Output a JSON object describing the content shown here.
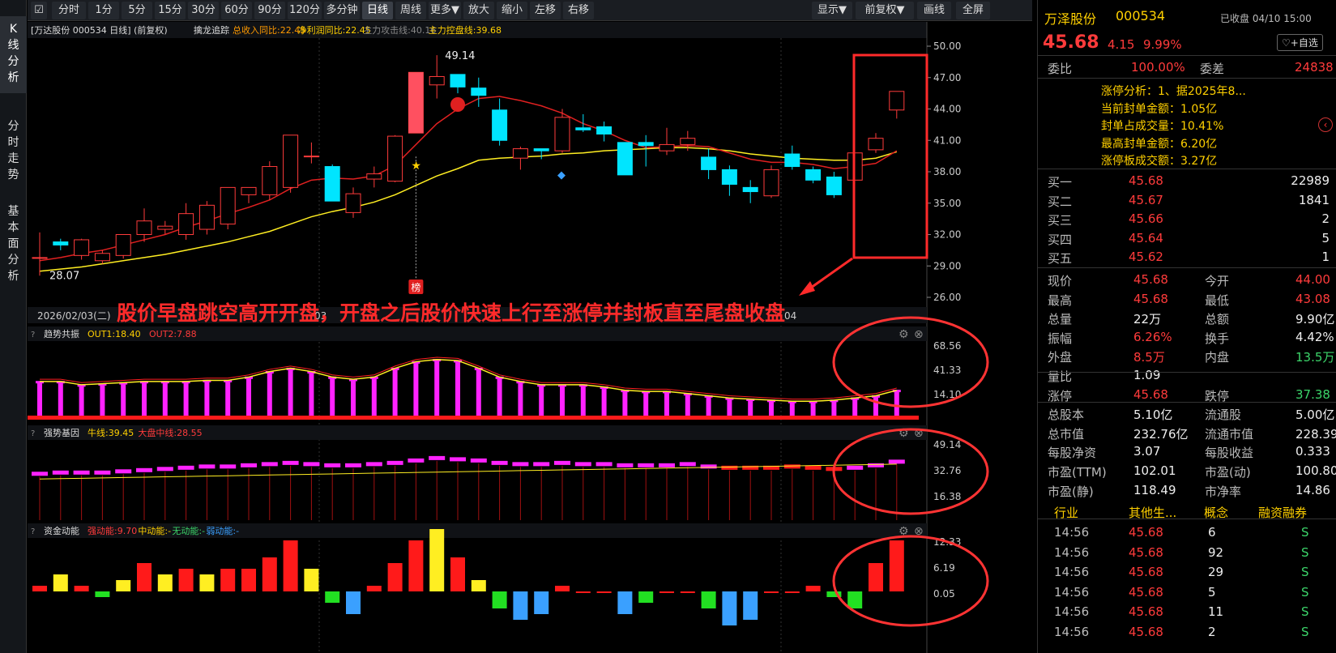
{
  "sidebar": {
    "tabs": [
      "K\n线\n分\n析",
      "分\n时\n走\n势",
      "基\n本\n面\n分\n析"
    ]
  },
  "toolbar": {
    "buttons": [
      "分时",
      "1分",
      "5分",
      "15分",
      "30分",
      "60分",
      "90分",
      "120分",
      "多分钟",
      "日线",
      "周线",
      "更多▼",
      "放大",
      "缩小",
      "左移",
      "右移"
    ],
    "active": "日线",
    "right_buttons": [
      "显示▼",
      "前复权▼",
      "画线",
      "全屏"
    ]
  },
  "main_header": {
    "title": "[万达股份 000534 日线]  (前复权)",
    "indicator": "擒龙追踪",
    "items": [
      "总收入同比:22.45",
      "净利润同比:22.45",
      "主力攻击线:40.16",
      "主力控盘线:39.68"
    ]
  },
  "price_axis": [
    "50.00",
    "47.00",
    "44.00",
    "41.00",
    "38.00",
    "35.00",
    "32.00",
    "29.00",
    "26.00"
  ],
  "annotations": {
    "high": "49.14",
    "low": "28.07",
    "date": "2026/02/03(二)",
    "month_mid": "03",
    "month_right": "04",
    "bang": "榜",
    "caption": "股价早盘跳空高开开盘，开盘之后股价快速上行至涨停并封板直至尾盘收盘"
  },
  "panel1": {
    "name": "趋势共振",
    "out1": "OUT1:18.40",
    "out2": "OUT2:7.88",
    "axis": [
      "68.56",
      "41.33",
      "14.10"
    ]
  },
  "panel2": {
    "name": "强势基因",
    "l1": "牛线:39.45",
    "l2": "大盘中线:28.55",
    "axis": [
      "49.14",
      "32.76",
      "16.38"
    ]
  },
  "panel3": {
    "name": "资金动能",
    "l1": "强动能:9.70",
    "l2": "中动能:-",
    "l3": "无动能:-",
    "l4": "弱动能:-",
    "axis": [
      "12.33",
      "6.19",
      "0.05"
    ]
  },
  "stock": {
    "name": "万泽股份",
    "code": "000534",
    "status": "已收盘 04/10 15:00",
    "price": "45.68",
    "change": "4.15",
    "pct": "9.99%",
    "fav": "+自选"
  },
  "weibi": {
    "label1": "委比",
    "val1": "100.00%",
    "label2": "委差",
    "val2": "24838"
  },
  "limit": {
    "lines": [
      "涨停分析：1、据2025年8...",
      "当前封单金额：1.05亿",
      "封单占成交量：10.41%",
      "最高封单金额：6.20亿",
      "涨停板成交额：3.27亿"
    ]
  },
  "bids": [
    [
      "买一",
      "45.68",
      "22989"
    ],
    [
      "买二",
      "45.67",
      "1841"
    ],
    [
      "买三",
      "45.66",
      "2"
    ],
    [
      "买四",
      "45.64",
      "5"
    ],
    [
      "买五",
      "45.62",
      "1"
    ]
  ],
  "quote": [
    [
      "现价",
      "45.68",
      "今开",
      "44.00"
    ],
    [
      "最高",
      "45.68",
      "最低",
      "43.08"
    ],
    [
      "总量",
      "22万",
      "总额",
      "9.90亿"
    ],
    [
      "振幅",
      "6.26%",
      "换手",
      "4.42%"
    ],
    [
      "外盘",
      "8.5万",
      "内盘",
      "13.5万"
    ],
    [
      "量比",
      "1.09",
      "",
      ""
    ],
    [
      "涨停",
      "45.68",
      "跌停",
      "37.38"
    ],
    [
      "总股本",
      "5.10亿",
      "流通股",
      "5.00亿"
    ],
    [
      "总市值",
      "232.76亿",
      "流通市值",
      "228.39亿"
    ],
    [
      "每股净资",
      "3.07",
      "每股收益",
      "0.333"
    ],
    [
      "市盈(TTM)",
      "102.01",
      "市盈(动)",
      "100.80"
    ],
    [
      "市盈(静)",
      "118.49",
      "市净率",
      "14.86"
    ]
  ],
  "tabs": [
    "行业",
    "其他生...",
    "概念",
    "融资融券"
  ],
  "ticks": [
    [
      "14:56",
      "45.68",
      "6",
      "S"
    ],
    [
      "14:56",
      "45.68",
      "92",
      "S"
    ],
    [
      "14:56",
      "45.68",
      "29",
      "S"
    ],
    [
      "14:56",
      "45.68",
      "5",
      "S"
    ],
    [
      "14:56",
      "45.68",
      "11",
      "S"
    ],
    [
      "14:56",
      "45.68",
      "2",
      "S"
    ]
  ],
  "chart_data": {
    "type": "candlestick",
    "ohlc": [
      [
        29.8,
        32.2,
        28.07,
        29.8
      ],
      [
        31.3,
        31.6,
        30.5,
        31
      ],
      [
        30,
        31.6,
        29.6,
        31.5
      ],
      [
        29.5,
        30.5,
        29.2,
        30.2
      ],
      [
        30,
        32,
        29.7,
        32
      ],
      [
        32,
        34.5,
        31.3,
        33.3
      ],
      [
        32.5,
        33.3,
        32,
        32.8
      ],
      [
        32,
        35,
        31.5,
        34
      ],
      [
        32.5,
        35.2,
        32,
        34.8
      ],
      [
        33,
        36.5,
        32.5,
        36.5
      ],
      [
        35.8,
        36.5,
        35,
        36.5
      ],
      [
        35.8,
        39,
        35.3,
        38.5
      ],
      [
        36.5,
        41.5,
        36,
        41.5
      ],
      [
        39.5,
        40.8,
        38.8,
        39.5
      ],
      [
        38.5,
        38.7,
        35.2,
        35.2
      ],
      [
        34.1,
        36.5,
        33.6,
        35.9
      ],
      [
        37.3,
        38.5,
        36.5,
        37.8
      ],
      [
        37.1,
        41.5,
        37,
        41.4
      ],
      [
        41.7,
        47.5,
        41.7,
        47.5
      ],
      [
        46.3,
        49.14,
        45,
        47.1
      ],
      [
        47.3,
        47.3,
        45.5,
        46.1
      ],
      [
        46,
        47,
        44.2,
        45.3
      ],
      [
        43.9,
        45,
        40.5,
        41
      ],
      [
        39.3,
        40.4,
        38.2,
        40.2
      ],
      [
        40.2,
        40.2,
        39.2,
        40
      ],
      [
        40,
        44,
        39.8,
        43.2
      ],
      [
        42.2,
        43.5,
        41.8,
        42
      ],
      [
        42.3,
        42.8,
        40.9,
        41.6
      ],
      [
        40.8,
        40.8,
        37.7,
        37.7
      ],
      [
        40.8,
        41.5,
        38.5,
        40.5
      ],
      [
        40,
        42.2,
        39.6,
        40.6
      ],
      [
        40.6,
        41.9,
        40,
        41.2
      ],
      [
        39.4,
        40.2,
        37.3,
        38.2
      ],
      [
        38.2,
        38.6,
        35.7,
        36.8
      ],
      [
        36.5,
        37.2,
        35,
        36.1
      ],
      [
        35.7,
        38.6,
        35.5,
        38.2
      ],
      [
        39.7,
        40.5,
        38.2,
        38.5
      ],
      [
        38.2,
        38.5,
        36.9,
        37.2
      ],
      [
        37.5,
        38,
        35.5,
        35.8
      ],
      [
        37.2,
        39.8,
        37.2,
        39.8
      ],
      [
        40.1,
        41.7,
        39.8,
        41.2
      ],
      [
        43.9,
        45.68,
        43.08,
        45.68
      ]
    ],
    "ma_red": [
      29.5,
      29.8,
      30.2,
      30.5,
      31,
      31.5,
      32,
      32.7,
      33.3,
      34,
      34.6,
      35.3,
      36.4,
      37.2,
      37.4,
      37.3,
      37.6,
      38.6,
      40.6,
      42.6,
      44,
      45,
      45.2,
      44.8,
      44.3,
      43.6,
      42.6,
      41.9,
      41,
      40.3,
      40.4,
      40.5,
      40.4,
      39.8,
      39.2,
      38.9,
      38.9,
      38.7,
      38.3,
      38.5,
      38.8,
      40
    ],
    "ma_yellow": [
      28.5,
      28.7,
      28.9,
      29.2,
      29.5,
      29.8,
      30.1,
      30.5,
      30.9,
      31.3,
      31.8,
      32.3,
      33,
      33.7,
      34.2,
      34.6,
      35.1,
      35.8,
      36.7,
      37.6,
      38.3,
      39.1,
      39.3,
      39.4,
      39.5,
      39.7,
      39.8,
      40,
      40.1,
      40.2,
      40.3,
      40.3,
      40.2,
      40,
      39.7,
      39.5,
      39.3,
      39.2,
      39.1,
      39.1,
      39.3,
      39.9
    ],
    "ylim": [
      26,
      50
    ],
    "title": "[万达股份 000534 日线]  (前复权)"
  }
}
